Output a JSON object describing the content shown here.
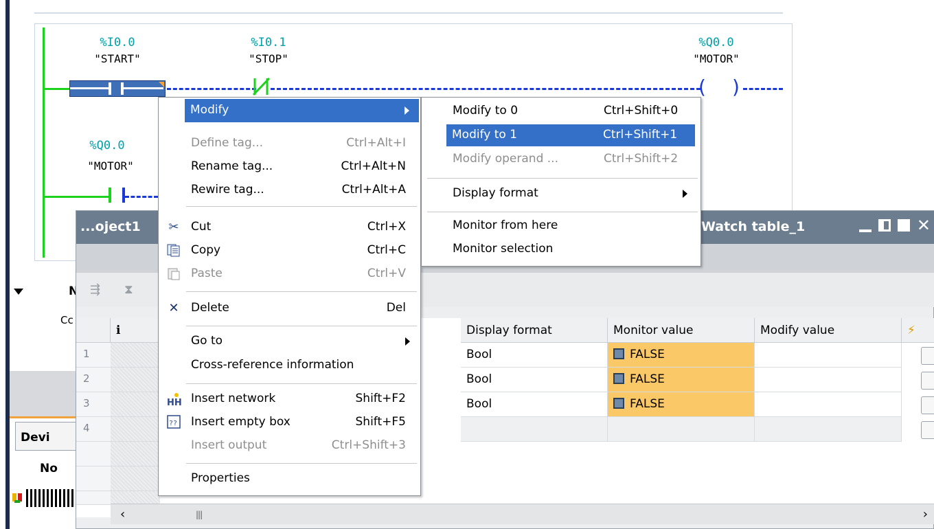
{
  "ladder": {
    "contact1": {
      "address": "%I0.0",
      "name": "\"START\""
    },
    "contact2": {
      "address": "%I0.1",
      "name": "\"STOP\""
    },
    "coil": {
      "address": "%Q0.0",
      "name": "\"MOTOR\""
    },
    "contact3": {
      "address": "%Q0.0",
      "name": "\"MOTOR\""
    }
  },
  "left_panel": {
    "label_n": "N",
    "label_cc": "Cc",
    "tab_devi": "Devi",
    "label_no": "No"
  },
  "watch_table": {
    "title_left": "...oject1",
    "title_right": "Watch table_1",
    "columns": {
      "info": "i",
      "display_format": "Display format",
      "monitor_value": "Monitor value",
      "modify_value": "Modify value"
    },
    "rows": [
      {
        "num": "1",
        "display_format": "Bool",
        "monitor_value": "FALSE"
      },
      {
        "num": "2",
        "display_format": "Bool",
        "monitor_value": "FALSE"
      },
      {
        "num": "3",
        "display_format": "Bool",
        "monitor_value": "FALSE"
      },
      {
        "num": "4",
        "display_format": "",
        "monitor_value": ""
      }
    ],
    "colors": {
      "monitor_bg": "#fbc868",
      "titlebar": "#6b7d8f"
    }
  },
  "context_menu": {
    "items": [
      {
        "label": "Modify",
        "shortcut": "",
        "submenu": true,
        "state": "highlighted"
      },
      {
        "label": "Define tag...",
        "shortcut": "Ctrl+Alt+I",
        "state": "disabled"
      },
      {
        "label": "Rename tag...",
        "shortcut": "Ctrl+Alt+N",
        "state": "enabled"
      },
      {
        "label": "Rewire tag...",
        "shortcut": "Ctrl+Alt+A",
        "state": "enabled"
      },
      {
        "label": "Cut",
        "shortcut": "Ctrl+X",
        "icon": "scissors-icon",
        "state": "enabled"
      },
      {
        "label": "Copy",
        "shortcut": "Ctrl+C",
        "icon": "copy-icon",
        "state": "enabled"
      },
      {
        "label": "Paste",
        "shortcut": "Ctrl+V",
        "icon": "paste-icon",
        "state": "disabled"
      },
      {
        "label": "Delete",
        "shortcut": "Del",
        "icon": "delete-x-icon",
        "state": "enabled"
      },
      {
        "label": "Go to",
        "shortcut": "",
        "submenu": true,
        "state": "enabled"
      },
      {
        "label": "Cross-reference information",
        "shortcut": "",
        "state": "enabled"
      },
      {
        "label": "Insert network",
        "shortcut": "Shift+F2",
        "icon": "insert-network-icon",
        "state": "enabled"
      },
      {
        "label": "Insert empty box",
        "shortcut": "Shift+F5",
        "icon": "insert-box-icon",
        "state": "enabled"
      },
      {
        "label": "Insert output",
        "shortcut": "Ctrl+Shift+3",
        "state": "disabled"
      },
      {
        "label": "Properties",
        "shortcut": "",
        "state": "enabled"
      }
    ],
    "highlight_color": "#3470c8"
  },
  "submenu": {
    "items": [
      {
        "label": "Modify to 0",
        "shortcut": "Ctrl+Shift+0",
        "state": "enabled"
      },
      {
        "label": "Modify to 1",
        "shortcut": "Ctrl+Shift+1",
        "state": "highlighted"
      },
      {
        "label": "Modify operand ...",
        "shortcut": "Ctrl+Shift+2",
        "state": "disabled"
      },
      {
        "label": "Display format",
        "shortcut": "",
        "submenu": true,
        "state": "enabled"
      },
      {
        "label": "Monitor from here",
        "shortcut": "",
        "state": "enabled"
      },
      {
        "label": "Monitor selection",
        "shortcut": "",
        "state": "enabled"
      }
    ]
  }
}
